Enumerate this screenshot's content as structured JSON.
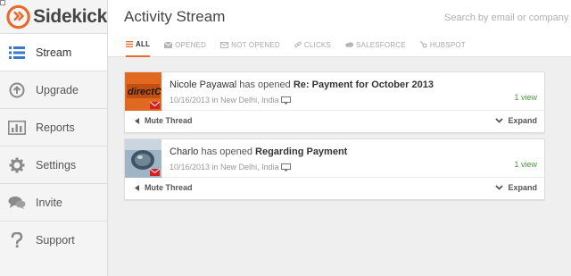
{
  "app": {
    "name": "Sidekick"
  },
  "sidebar": {
    "items": [
      {
        "label": "Stream",
        "icon": "list-icon",
        "active": true
      },
      {
        "label": "Upgrade",
        "icon": "arrow-up-circle-icon",
        "active": false
      },
      {
        "label": "Reports",
        "icon": "bar-chart-icon",
        "active": false
      },
      {
        "label": "Settings",
        "icon": "gear-icon",
        "active": false
      },
      {
        "label": "Invite",
        "icon": "chat-bubbles-icon",
        "active": false
      },
      {
        "label": "Support",
        "icon": "question-icon",
        "active": false
      }
    ]
  },
  "header": {
    "title": "Activity Stream",
    "search_placeholder": "Search by email or company e"
  },
  "tabs": [
    {
      "label": "ALL",
      "icon": "list-icon",
      "active": true
    },
    {
      "label": "OPENED",
      "icon": "envelope-icon",
      "active": false
    },
    {
      "label": "NOT OPENED",
      "icon": "envelope-icon",
      "active": false
    },
    {
      "label": "CLICKS",
      "icon": "link-icon",
      "active": false
    },
    {
      "label": "SALESFORCE",
      "icon": "cloud-icon",
      "active": false
    },
    {
      "label": "HUBSPOT",
      "icon": "sprocket-icon",
      "active": false
    }
  ],
  "stream": [
    {
      "person": "Nicole Payawal",
      "action": "has opened",
      "subject": "Re: Payment for October 2013",
      "meta": "10/16/2013 in New Delhi, India",
      "views": "1 view",
      "mute": "Mute Thread",
      "expand": "Expand",
      "thumb_text": "directCPV"
    },
    {
      "person": "Charlo",
      "action": "has opened",
      "subject": "Regarding Payment",
      "meta": "10/16/2013 in New Delhi, India",
      "views": "1 view",
      "mute": "Mute Thread",
      "expand": "Expand"
    }
  ],
  "colors": {
    "accent": "#e8692a",
    "views": "#4a9a3a",
    "icon": "#3a78c8"
  }
}
